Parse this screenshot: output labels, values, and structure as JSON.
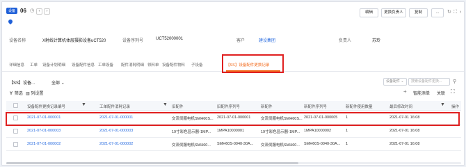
{
  "header": {
    "badge": "设备",
    "record_number": "06",
    "buttons": {
      "edit": "编辑",
      "change_owner": "更换负责人",
      "copy": "复制",
      "more": "..."
    }
  },
  "info": {
    "device_name_label": "设备名称",
    "device_name_value": "X射线计算机体层摄影设备uCT520",
    "serial_label": "设备序列号",
    "serial_value": "UCT52000001",
    "customer_label": "客户",
    "customer_value": "建设集团",
    "owner_label": "负责人",
    "owner_value": "苏玲"
  },
  "tabs": [
    {
      "label": "详细信息"
    },
    {
      "label": "工单"
    },
    {
      "label": "设备计划明细"
    },
    {
      "label": "设备配件信息"
    },
    {
      "label": "工单设备"
    },
    {
      "label": "配件消耗明细"
    },
    {
      "label": "领料单"
    },
    {
      "label": "设备配件物料"
    },
    {
      "label": "子设备"
    },
    {
      "label": "【SS】设备配件更换记录"
    }
  ],
  "subtoolbar": {
    "object_title": "【SS】设备...",
    "view_select": "全部",
    "filter_button": "筛选",
    "columns_button": "列设置",
    "search_field_select": "设备配件",
    "search_placeholder": "搜索设备配件更换...",
    "add_button": "+",
    "smart_add_button": "智能添单",
    "relate_button": "关联"
  },
  "table": {
    "headers": [
      "设备配件更换记录编号",
      "工单配件消耗记录",
      "旧配件",
      "旧配件序列号",
      "新配件",
      "新配件序列号",
      "新配件使用数量",
      "最后修改时间",
      "操作"
    ],
    "rows": [
      [
        "2021-07-01-000001",
        "2021-07-01-000001",
        "交流伺服电机SMH60S...",
        "2021-07-01-000001",
        "交流伺服电机SMH60S...",
        "2021-07-01-000005",
        "1",
        "2021-07-01 16:08"
      ],
      [
        "2021-07-01-000003",
        "2021-07-01-000003",
        "19寸彩色显示器-1MP...",
        "1MPA10000001",
        "19寸彩色显示器-1MP...",
        "1MPA10000002",
        "1",
        "2021-07-01 16:08"
      ],
      [
        "2021-07-01-000002",
        "2021-07-01-000002",
        "交流伺服电机SMH60...",
        "SMH60S-0040-30A...",
        "交流伺服电机SMH60...",
        "SMH60S-0040-30A...",
        "1",
        "2021-07-01 16:08"
      ]
    ]
  },
  "colors": {
    "accent": "#2a6de0",
    "active_tab": "#f26b1d",
    "highlight": "#e02020"
  }
}
